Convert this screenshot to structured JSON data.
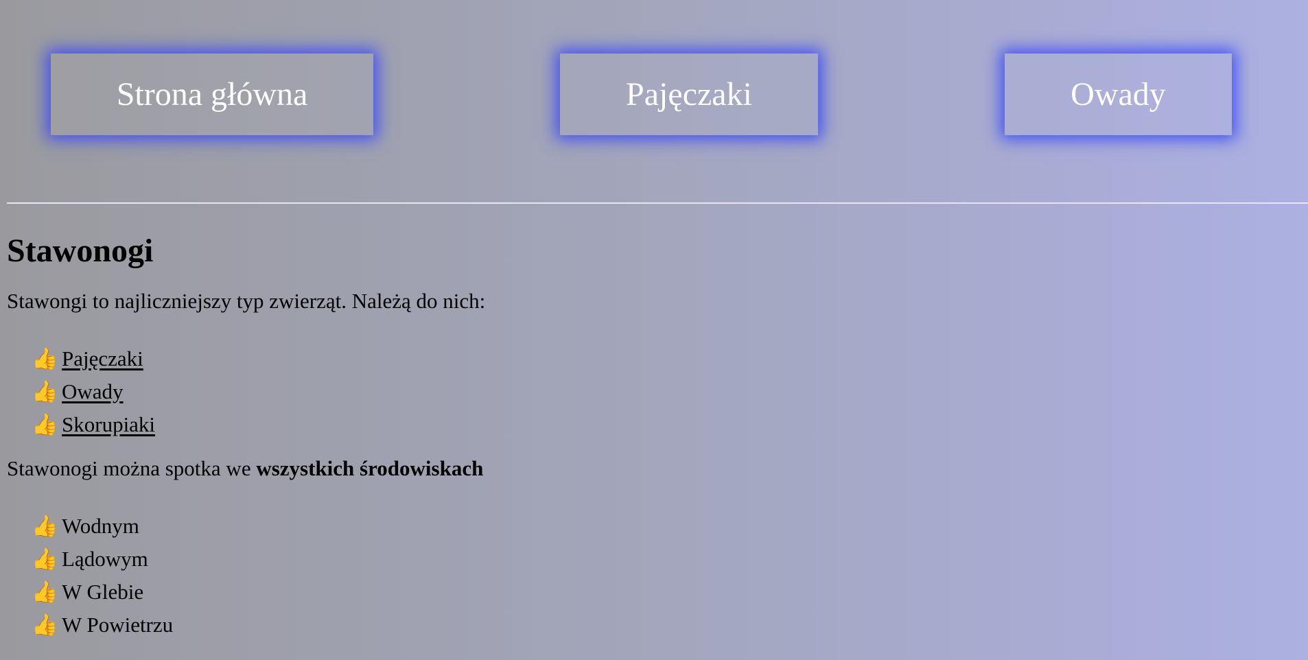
{
  "nav": {
    "home": "Strona główna",
    "spiders": "Pajęczaki",
    "insects": "Owady"
  },
  "colors": {
    "button_glow": "#3c4bf5",
    "background_left": "#9a9a9e",
    "background_right": "#acb0e2"
  },
  "main": {
    "title": "Stawonogi",
    "intro": "Stawongi to najliczniejszy typ zwierząt. Należą do nich:",
    "groups": [
      {
        "icon": "thumbs-up-icon",
        "label": "Pajęczaki"
      },
      {
        "icon": "thumbs-up-icon",
        "label": "Owady"
      },
      {
        "icon": "thumbs-up-icon",
        "label": "Skorupiaki"
      }
    ],
    "env_text": "Stawonogi można spotka we ",
    "env_bold": "wszystkich środowiskach",
    "environments": [
      {
        "icon": "thumbs-up-icon",
        "label": "Wodnym"
      },
      {
        "icon": "thumbs-up-icon",
        "label": "Lądowym"
      },
      {
        "icon": "thumbs-up-icon",
        "label": "W Glebie"
      },
      {
        "icon": "thumbs-up-icon",
        "label": "W Powietrzu"
      }
    ]
  }
}
